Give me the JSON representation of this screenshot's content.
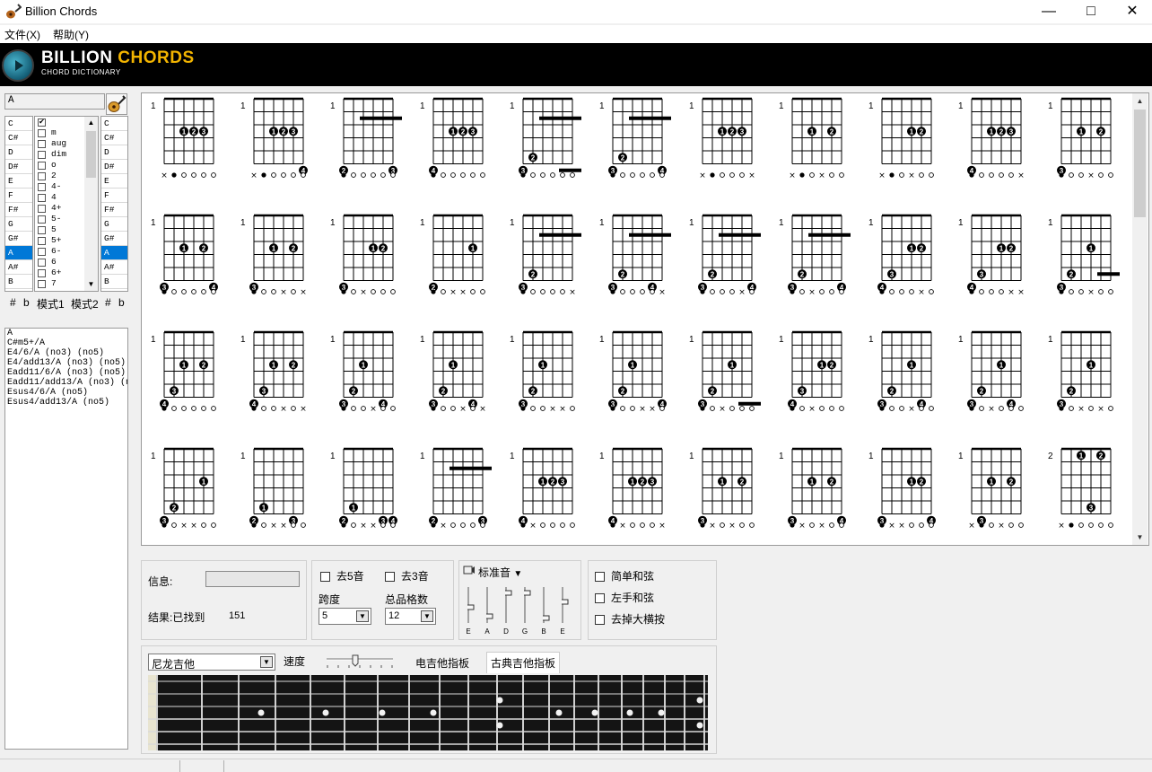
{
  "window": {
    "title": "Billion Chords",
    "controls": [
      "minimize",
      "maximize",
      "close"
    ]
  },
  "menu": {
    "items": [
      "文件(X)",
      "帮助(Y)"
    ]
  },
  "banner": {
    "title_left": "BILLION",
    "title_right": "CHORDS",
    "subtitle": "CHORD DICTIONARY"
  },
  "left": {
    "chord_input_value": "A",
    "root_list": [
      "C",
      "C#",
      "D",
      "D#",
      "E",
      "F",
      "F#",
      "G",
      "G#",
      "A",
      "A#",
      "B"
    ],
    "root_selected": "A",
    "modifier_list": [
      {
        "label": "",
        "checked": true
      },
      {
        "label": "m",
        "checked": false
      },
      {
        "label": "aug",
        "checked": false
      },
      {
        "label": "dim",
        "checked": false
      },
      {
        "label": "o",
        "checked": false
      },
      {
        "label": "2",
        "checked": false
      },
      {
        "label": "4-",
        "checked": false
      },
      {
        "label": "4",
        "checked": false
      },
      {
        "label": "4+",
        "checked": false
      },
      {
        "label": "5-",
        "checked": false
      },
      {
        "label": "5",
        "checked": false
      },
      {
        "label": "5+",
        "checked": false
      },
      {
        "label": "6-",
        "checked": false
      },
      {
        "label": "6",
        "checked": false
      },
      {
        "label": "6+",
        "checked": false
      },
      {
        "label": "7",
        "checked": false
      }
    ],
    "bass_list": [
      "C",
      "C#",
      "D",
      "D#",
      "E",
      "F",
      "F#",
      "G",
      "G#",
      "A",
      "A#",
      "B"
    ],
    "bass_selected": "A",
    "tabs": [
      "#",
      "b",
      "模式1",
      "模式2",
      "#",
      "b"
    ],
    "results": [
      "A",
      "C#m5+/A",
      "E4/6/A (no3) (no5)",
      "E4/add13/A (no3) (no5)",
      "Eadd11/6/A (no3) (no5)",
      "Eadd11/add13/A (no3) (n",
      "Esus4/6/A (no5)",
      "Esus4/add13/A (no5)"
    ]
  },
  "chords": [
    {
      "fret": "1",
      "dots": [
        [
          2,
          3,
          "1"
        ],
        [
          3,
          3,
          "2"
        ],
        [
          4,
          3,
          "3"
        ]
      ],
      "open": "x●○○○○"
    },
    {
      "fret": "1",
      "dots": [
        [
          2,
          3,
          "1"
        ],
        [
          3,
          3,
          "2"
        ],
        [
          4,
          3,
          "3"
        ],
        [
          5,
          6,
          "4"
        ]
      ],
      "open": "x●○○○○"
    },
    {
      "fret": "1",
      "dots": [
        [
          0,
          6,
          "2"
        ],
        [
          5,
          6,
          "3"
        ]
      ],
      "barre": [
        2,
        5,
        2
      ],
      "open": "●○○○○○"
    },
    {
      "fret": "1",
      "dots": [
        [
          0,
          6,
          "4"
        ],
        [
          2,
          3,
          "1"
        ],
        [
          3,
          3,
          "2"
        ],
        [
          4,
          3,
          "3"
        ]
      ],
      "open": "●○○○○○"
    },
    {
      "fret": "1",
      "dots": [
        [
          0,
          6,
          "3"
        ],
        [
          1,
          5,
          "2"
        ]
      ],
      "barre": [
        2,
        5,
        2
      ],
      "barre2": [
        4,
        5,
        6
      ],
      "open": "●○○○○○"
    },
    {
      "fret": "1",
      "dots": [
        [
          0,
          6,
          "3"
        ],
        [
          1,
          5,
          "2"
        ],
        [
          5,
          6,
          "4"
        ]
      ],
      "barre": [
        2,
        5,
        2
      ],
      "open": "●○○○○○"
    },
    {
      "fret": "1",
      "dots": [
        [
          2,
          3,
          "1"
        ],
        [
          3,
          3,
          "2"
        ],
        [
          4,
          3,
          "3"
        ]
      ],
      "open": "x●○○○x"
    },
    {
      "fret": "1",
      "dots": [
        [
          2,
          3,
          "1"
        ],
        [
          4,
          3,
          "2"
        ]
      ],
      "open": "x●○x○○"
    },
    {
      "fret": "1",
      "dots": [
        [
          3,
          3,
          "1"
        ],
        [
          4,
          3,
          "2"
        ]
      ],
      "open": "x●○x○○"
    },
    {
      "fret": "1",
      "dots": [
        [
          0,
          6,
          "4"
        ],
        [
          2,
          3,
          "1"
        ],
        [
          3,
          3,
          "2"
        ],
        [
          4,
          3,
          "3"
        ]
      ],
      "open": "●○○○○x"
    },
    {
      "fret": "1",
      "dots": [
        [
          0,
          6,
          "3"
        ],
        [
          2,
          3,
          "1"
        ],
        [
          4,
          3,
          "2"
        ]
      ],
      "open": "●○○x○○"
    },
    {
      "fret": "1",
      "dots": [
        [
          0,
          6,
          "3"
        ],
        [
          2,
          3,
          "1"
        ],
        [
          4,
          3,
          "2"
        ],
        [
          5,
          6,
          "4"
        ]
      ],
      "open": "●○○○○○"
    },
    {
      "fret": "1",
      "dots": [
        [
          0,
          6,
          "3"
        ],
        [
          2,
          3,
          "1"
        ],
        [
          4,
          3,
          "2"
        ]
      ],
      "open": "●○○x○x"
    },
    {
      "fret": "1",
      "dots": [
        [
          0,
          6,
          "3"
        ],
        [
          3,
          3,
          "1"
        ],
        [
          4,
          3,
          "2"
        ]
      ],
      "open": "●○x○○○"
    },
    {
      "fret": "1",
      "dots": [
        [
          0,
          6,
          "2"
        ],
        [
          4,
          3,
          "1"
        ]
      ],
      "open": "●○x×○○"
    },
    {
      "fret": "1",
      "dots": [
        [
          0,
          6,
          "3"
        ],
        [
          1,
          5,
          "2"
        ]
      ],
      "barre": [
        2,
        5,
        2
      ],
      "open": "●○○○○x"
    },
    {
      "fret": "1",
      "dots": [
        [
          0,
          6,
          "3"
        ],
        [
          1,
          5,
          "2"
        ],
        [
          4,
          6,
          "4"
        ]
      ],
      "barre": [
        2,
        5,
        2
      ],
      "open": "●○○○○x"
    },
    {
      "fret": "1",
      "dots": [
        [
          0,
          6,
          "3"
        ],
        [
          1,
          5,
          "2"
        ],
        [
          5,
          6,
          "4"
        ]
      ],
      "barre": [
        2,
        5,
        2
      ],
      "open": "●○○○x○"
    },
    {
      "fret": "1",
      "dots": [
        [
          0,
          6,
          "3"
        ],
        [
          1,
          5,
          "2"
        ],
        [
          5,
          6,
          "4"
        ]
      ],
      "barre": [
        2,
        5,
        2
      ],
      "open": "●○x○○○"
    },
    {
      "fret": "1",
      "dots": [
        [
          0,
          6,
          "4"
        ],
        [
          1,
          5,
          "3"
        ],
        [
          3,
          3,
          "1"
        ],
        [
          4,
          3,
          "2"
        ]
      ],
      "open": "●○○○x○"
    },
    {
      "fret": "1",
      "dots": [
        [
          0,
          6,
          "4"
        ],
        [
          1,
          5,
          "3"
        ],
        [
          3,
          3,
          "1"
        ],
        [
          4,
          3,
          "2"
        ]
      ],
      "open": "●○○○xx"
    },
    {
      "fret": "1",
      "dots": [
        [
          0,
          6,
          "3"
        ],
        [
          1,
          5,
          "2"
        ],
        [
          3,
          3,
          "1"
        ]
      ],
      "barre2": [
        4,
        5,
        5
      ],
      "open": "●○○x○○"
    },
    {
      "fret": "1",
      "dots": [
        [
          0,
          6,
          "4"
        ],
        [
          1,
          5,
          "3"
        ],
        [
          2,
          3,
          "1"
        ],
        [
          4,
          3,
          "2"
        ]
      ],
      "open": "●○○○○○"
    },
    {
      "fret": "1",
      "dots": [
        [
          0,
          6,
          "4"
        ],
        [
          1,
          5,
          "3"
        ],
        [
          2,
          3,
          "1"
        ],
        [
          4,
          3,
          "2"
        ]
      ],
      "open": "●○○x○x"
    },
    {
      "fret": "1",
      "dots": [
        [
          0,
          6,
          "3"
        ],
        [
          1,
          5,
          "2"
        ],
        [
          2,
          3,
          "1"
        ],
        [
          4,
          6,
          "4"
        ]
      ],
      "open": "●○○x○○"
    },
    {
      "fret": "1",
      "dots": [
        [
          0,
          6,
          "3"
        ],
        [
          1,
          5,
          "2"
        ],
        [
          2,
          3,
          "1"
        ],
        [
          4,
          6,
          "4"
        ]
      ],
      "open": "●○○x○x"
    },
    {
      "fret": "1",
      "dots": [
        [
          0,
          6,
          "3"
        ],
        [
          1,
          5,
          "2"
        ],
        [
          2,
          3,
          "1"
        ]
      ],
      "open": "●○○xx○"
    },
    {
      "fret": "1",
      "dots": [
        [
          0,
          6,
          "3"
        ],
        [
          1,
          5,
          "2"
        ],
        [
          2,
          3,
          "1"
        ],
        [
          5,
          6,
          "4"
        ]
      ],
      "open": "●○○xx○"
    },
    {
      "fret": "1",
      "dots": [
        [
          0,
          6,
          "3"
        ],
        [
          1,
          5,
          "2"
        ],
        [
          3,
          3,
          "1"
        ]
      ],
      "barre2": [
        4,
        5,
        6
      ],
      "open": "●○x○○○"
    },
    {
      "fret": "1",
      "dots": [
        [
          0,
          6,
          "4"
        ],
        [
          1,
          5,
          "3"
        ],
        [
          3,
          3,
          "1"
        ],
        [
          4,
          3,
          "2"
        ]
      ],
      "open": "●○x○○○"
    },
    {
      "fret": "1",
      "dots": [
        [
          0,
          6,
          "3"
        ],
        [
          1,
          5,
          "2"
        ],
        [
          3,
          3,
          "1"
        ],
        [
          4,
          6,
          "4"
        ]
      ],
      "open": "●○○x○○"
    },
    {
      "fret": "1",
      "dots": [
        [
          0,
          6,
          "3"
        ],
        [
          1,
          5,
          "2"
        ],
        [
          3,
          3,
          "1"
        ],
        [
          4,
          6,
          "4"
        ]
      ],
      "open": "●○x○○○"
    },
    {
      "fret": "1",
      "dots": [
        [
          0,
          6,
          "3"
        ],
        [
          1,
          5,
          "2"
        ],
        [
          3,
          3,
          "1"
        ]
      ],
      "open": "●○x○x○"
    },
    {
      "fret": "1",
      "dots": [
        [
          0,
          6,
          "3"
        ],
        [
          1,
          5,
          "2"
        ],
        [
          4,
          3,
          "1"
        ]
      ],
      "open": "●○x×○○"
    },
    {
      "fret": "1",
      "dots": [
        [
          0,
          6,
          "2"
        ],
        [
          1,
          5,
          "1"
        ],
        [
          4,
          6,
          "3"
        ]
      ],
      "open": "●○x×○○"
    },
    {
      "fret": "1",
      "dots": [
        [
          0,
          6,
          "2"
        ],
        [
          1,
          5,
          "1"
        ],
        [
          4,
          6,
          "3"
        ],
        [
          5,
          6,
          "4"
        ]
      ],
      "open": "●○x×○○"
    },
    {
      "fret": "1",
      "dots": [
        [
          0,
          6,
          "2"
        ],
        [
          5,
          6,
          "3"
        ]
      ],
      "barre": [
        2,
        5,
        2
      ],
      "open": "●x○○○○"
    },
    {
      "fret": "1",
      "dots": [
        [
          0,
          6,
          "4"
        ],
        [
          2,
          3,
          "1"
        ],
        [
          3,
          3,
          "2"
        ],
        [
          4,
          3,
          "3"
        ]
      ],
      "open": "●x○○○○"
    },
    {
      "fret": "1",
      "dots": [
        [
          0,
          6,
          "4"
        ],
        [
          2,
          3,
          "1"
        ],
        [
          3,
          3,
          "2"
        ],
        [
          4,
          3,
          "3"
        ]
      ],
      "open": "●x○○○x"
    },
    {
      "fret": "1",
      "dots": [
        [
          0,
          6,
          "3"
        ],
        [
          2,
          3,
          "1"
        ],
        [
          4,
          3,
          "2"
        ]
      ],
      "open": "●x○x○○"
    },
    {
      "fret": "1",
      "dots": [
        [
          0,
          6,
          "3"
        ],
        [
          2,
          3,
          "1"
        ],
        [
          4,
          3,
          "2"
        ],
        [
          5,
          6,
          "4"
        ]
      ],
      "open": "●x○x○○"
    },
    {
      "fret": "1",
      "dots": [
        [
          0,
          6,
          "3"
        ],
        [
          3,
          3,
          "1"
        ],
        [
          4,
          3,
          "2"
        ],
        [
          5,
          6,
          "4"
        ]
      ],
      "open": "●xx○○○"
    },
    {
      "fret": "1",
      "dots": [
        [
          1,
          6,
          "3"
        ],
        [
          2,
          3,
          "1"
        ],
        [
          4,
          3,
          "2"
        ]
      ],
      "open": "x●○x○○"
    },
    {
      "fret": "2",
      "dots": [
        [
          2,
          1,
          "1"
        ],
        [
          4,
          1,
          "2"
        ],
        [
          3,
          5,
          "3"
        ]
      ],
      "open": "x●○○○○"
    }
  ],
  "controls": {
    "info_label": "信息:",
    "result_label": "结果:已找到",
    "result_count": "151",
    "drop5_label": "去5音",
    "drop3_label": "去3音",
    "span_label": "跨度",
    "span_value": "5",
    "total_frets_label": "总品格数",
    "total_frets_value": "12",
    "tuning_label": "标准音",
    "tuning_strings": [
      "E",
      "A",
      "D",
      "G",
      "B",
      "E"
    ],
    "simple_label": "简单和弦",
    "lefthand_label": "左手和弦",
    "nobarre_label": "去掉大横按",
    "guitar_type": "尼龙吉他",
    "speed_label": "速度",
    "electric_label": "电吉他指板",
    "classical_label": "古典吉他指板"
  },
  "colors": {
    "accent": "#f2b400",
    "selection": "#0078d7",
    "banner": "#000000"
  }
}
